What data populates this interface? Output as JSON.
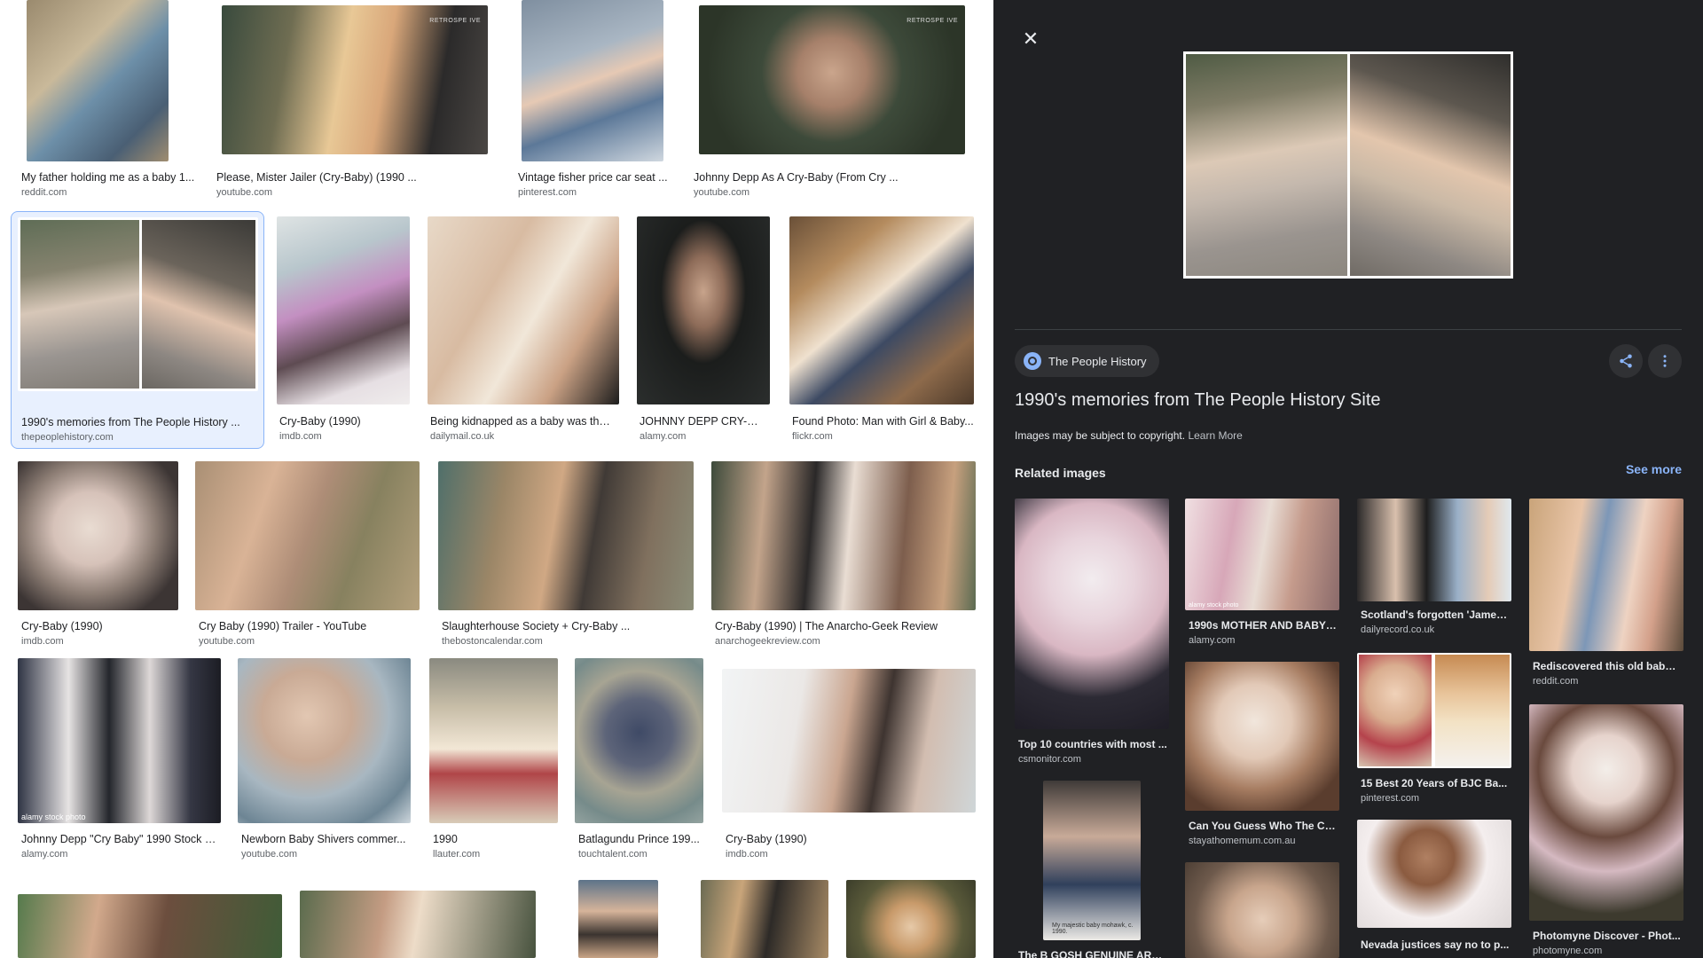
{
  "grid": {
    "row1": [
      {
        "caption": "My father holding me as a baby 1...",
        "source": "reddit.com"
      },
      {
        "caption": "Please, Mister Jailer (Cry-Baby) (1990 ...",
        "source": "youtube.com",
        "watermark": "RETROSPE   IVE"
      },
      {
        "caption": "Vintage fisher price car seat ...",
        "source": "pinterest.com"
      },
      {
        "caption": "Johnny Depp As A Cry-Baby (From Cry ...",
        "source": "youtube.com",
        "watermark": "RETROSPE   IVE"
      }
    ],
    "row2": [
      {
        "caption": "1990's memories from The People History ...",
        "source": "thepeoplehistory.com"
      },
      {
        "caption": "Cry-Baby (1990)",
        "source": "imdb.com"
      },
      {
        "caption": "Being kidnapped as a baby was the ...",
        "source": "dailymail.co.uk"
      },
      {
        "caption": "JOHNNY DEPP CRY-BA...",
        "source": "alamy.com"
      },
      {
        "caption": "Found Photo: Man with Girl & Baby...",
        "source": "flickr.com"
      }
    ],
    "row3": [
      {
        "caption": "Cry-Baby (1990)",
        "source": "imdb.com"
      },
      {
        "caption": "Cry Baby (1990) Trailer - YouTube",
        "source": "youtube.com"
      },
      {
        "caption": "Slaughterhouse Society + Cry-Baby ...",
        "source": "thebostoncalendar.com"
      },
      {
        "caption": "Cry-Baby (1990) | The Anarcho-Geek Review",
        "source": "anarchogeekreview.com"
      }
    ],
    "row4": [
      {
        "caption": "Johnny Depp \"Cry Baby\" 1990 Stock P...",
        "source": "alamy.com",
        "watermark": "alamy stock photo"
      },
      {
        "caption": "Newborn Baby Shivers commer...",
        "source": "youtube.com"
      },
      {
        "caption": "1990",
        "source": "llauter.com"
      },
      {
        "caption": "Batlagundu Prince 199...",
        "source": "touchtalent.com"
      },
      {
        "caption": "Cry-Baby (1990)",
        "source": "imdb.com"
      }
    ]
  },
  "panel": {
    "close_icon": "close-icon",
    "site_name": "The People History",
    "title": "1990's memories from The People History Site",
    "copyright": "Images may be subject to copyright.",
    "learn_more": "Learn More",
    "related_heading": "Related images",
    "see_more": "See more",
    "related": [
      {
        "caption": "Top 10 countries with most ...",
        "source": "csmonitor.com"
      },
      {
        "caption": "1990s MOTHER AND BABY ...",
        "source": "alamy.com",
        "watermark": "alamy stock photo"
      },
      {
        "caption": "Scotland's forgotten 'James...",
        "source": "dailyrecord.co.uk"
      },
      {
        "caption": "Rediscovered this old baby ...",
        "source": "reddit.com"
      },
      {
        "caption": "Can You Guess Who The Cel...",
        "source": "stayathomemum.com.au"
      },
      {
        "caption": "15 Best 20 Years of BJC Ba...",
        "source": "pinterest.com"
      },
      {
        "caption": "The B GOSH GENUINE ARTI...",
        "source": "",
        "note": "My majestic baby mohawk, c. 1990."
      },
      {
        "caption": "Nevada justices say no to p...",
        "source": ""
      },
      {
        "caption": "Photomyne Discover - Phot...",
        "source": "photomyne.com"
      }
    ]
  },
  "colors": {
    "panel_bg": "#202124",
    "accent": "#8ab4f8",
    "selected_bg": "#e8f0fe"
  }
}
